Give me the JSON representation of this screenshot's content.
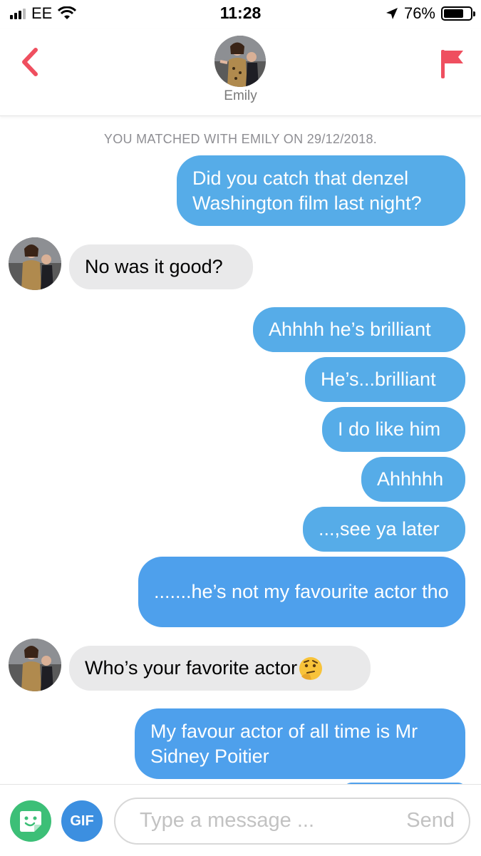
{
  "status": {
    "carrier": "EE",
    "time": "11:28",
    "battery": "76%"
  },
  "header": {
    "name": "Emily"
  },
  "match_notice": "YOU MATCHED WITH EMILY ON 29/12/2018.",
  "messages": [
    {
      "from": "me",
      "text": "Did you catch that denzel Washington film last night?"
    },
    {
      "from": "emily",
      "text": "No was it good?"
    },
    {
      "from": "me",
      "text": "Ahhhh he’s brilliant"
    },
    {
      "from": "me",
      "text": "He’s...brilliant"
    },
    {
      "from": "me",
      "text": "I do like him"
    },
    {
      "from": "me",
      "text": "Ahhhhh"
    },
    {
      "from": "me",
      "text": "...,see ya later"
    },
    {
      "from": "me",
      "text": ".......he’s not my favourite actor tho"
    },
    {
      "from": "emily",
      "text": "Who’s your favorite actor"
    },
    {
      "from": "me",
      "text": "My favour actor of all time is Mr Sidney Poitier"
    }
  ],
  "composer": {
    "gif_label": "GIF",
    "placeholder": "Type a message ...",
    "send_label": "Send"
  },
  "colors": {
    "accent": "#ef4f5f",
    "sent_bubble": "#56ace8",
    "received_bubble": "#e9e9ea",
    "sticker_button": "#3cbf77",
    "gif_button": "#3c8fe0"
  },
  "icons": {
    "back": "chevron-left-icon",
    "report": "flag-icon",
    "sticker": "sticker-icon",
    "thinking": "thinking-face-emoji"
  }
}
